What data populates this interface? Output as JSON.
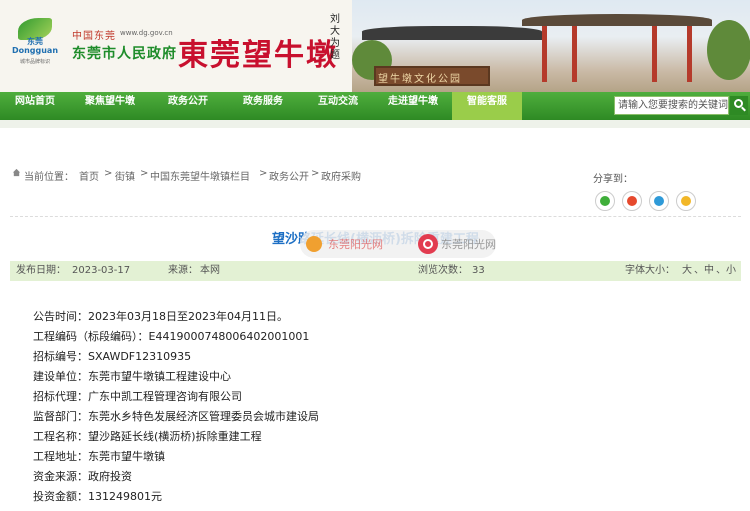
{
  "header": {
    "logo_city": "东莞",
    "logo_en": "Dongguan",
    "logo_small": "城市品牌标识",
    "gov_cn": "中国东莞",
    "gov_url": "www.dg.gov.cn",
    "gov_name": "东莞市人民政府",
    "town_title": "東莞望牛墩",
    "calligraphy": "刘大为题",
    "stone_text": "望牛墩文化公园"
  },
  "nav": {
    "items": [
      "网站首页",
      "聚焦望牛墩",
      "政务公开",
      "政务服务",
      "互动交流",
      "走进望牛墩",
      "智能客服"
    ],
    "active_index": 6,
    "search_placeholder": "请输入您要搜索的关键词"
  },
  "breadcrumb": {
    "label": "当前位置：",
    "parts": [
      "首页",
      "街镇",
      "中国东莞望牛墩镇栏目",
      "政务公开",
      "政府采购"
    ],
    "separator": ">"
  },
  "share": {
    "label": "分享到：",
    "icons": [
      "wechat-icon",
      "weibo-icon",
      "qq-icon",
      "qzone-icon"
    ]
  },
  "article": {
    "title": "望沙路延长线(横沥桥)拆除重建工程",
    "watermark_text": "东莞阳光网",
    "watermark_badge": "东莞阳光网",
    "publish_date_label": "发布日期：",
    "publish_date": "2023-03-17",
    "source_label": "来源：",
    "source": "本网",
    "views_label": "浏览次数：",
    "views": "33",
    "font_size_label": "字体大小：",
    "font_sizes": [
      "大",
      "中",
      "小"
    ]
  },
  "details": [
    {
      "label": "公告时间：",
      "value": "2023年03月18日至2023年04月11日。"
    },
    {
      "label": "工程编码（标段编码）：",
      "value": "E4419000748006402001001"
    },
    {
      "label": "招标编号：",
      "value": "SXAWDF12310935"
    },
    {
      "label": "建设单位：",
      "value": "东莞市望牛墩镇工程建设中心"
    },
    {
      "label": "招标代理：",
      "value": "广东中凯工程管理咨询有限公司"
    },
    {
      "label": "监督部门：",
      "value": "东莞水乡特色发展经济区管理委员会城市建设局"
    },
    {
      "label": "工程名称：",
      "value": "望沙路延长线(横沥桥)拆除重建工程"
    },
    {
      "label": "工程地址：",
      "value": "东莞市望牛墩镇"
    },
    {
      "label": "资金来源：",
      "value": "政府投资"
    },
    {
      "label": "投资金额：",
      "value": "131249801元"
    }
  ],
  "colors": {
    "nav_green": "#2e8a24",
    "nav_active": "#9acd4a",
    "title_blue": "#1d6fc4",
    "brand_red": "#c8102e",
    "meta_bg": "#e3f1d4"
  }
}
